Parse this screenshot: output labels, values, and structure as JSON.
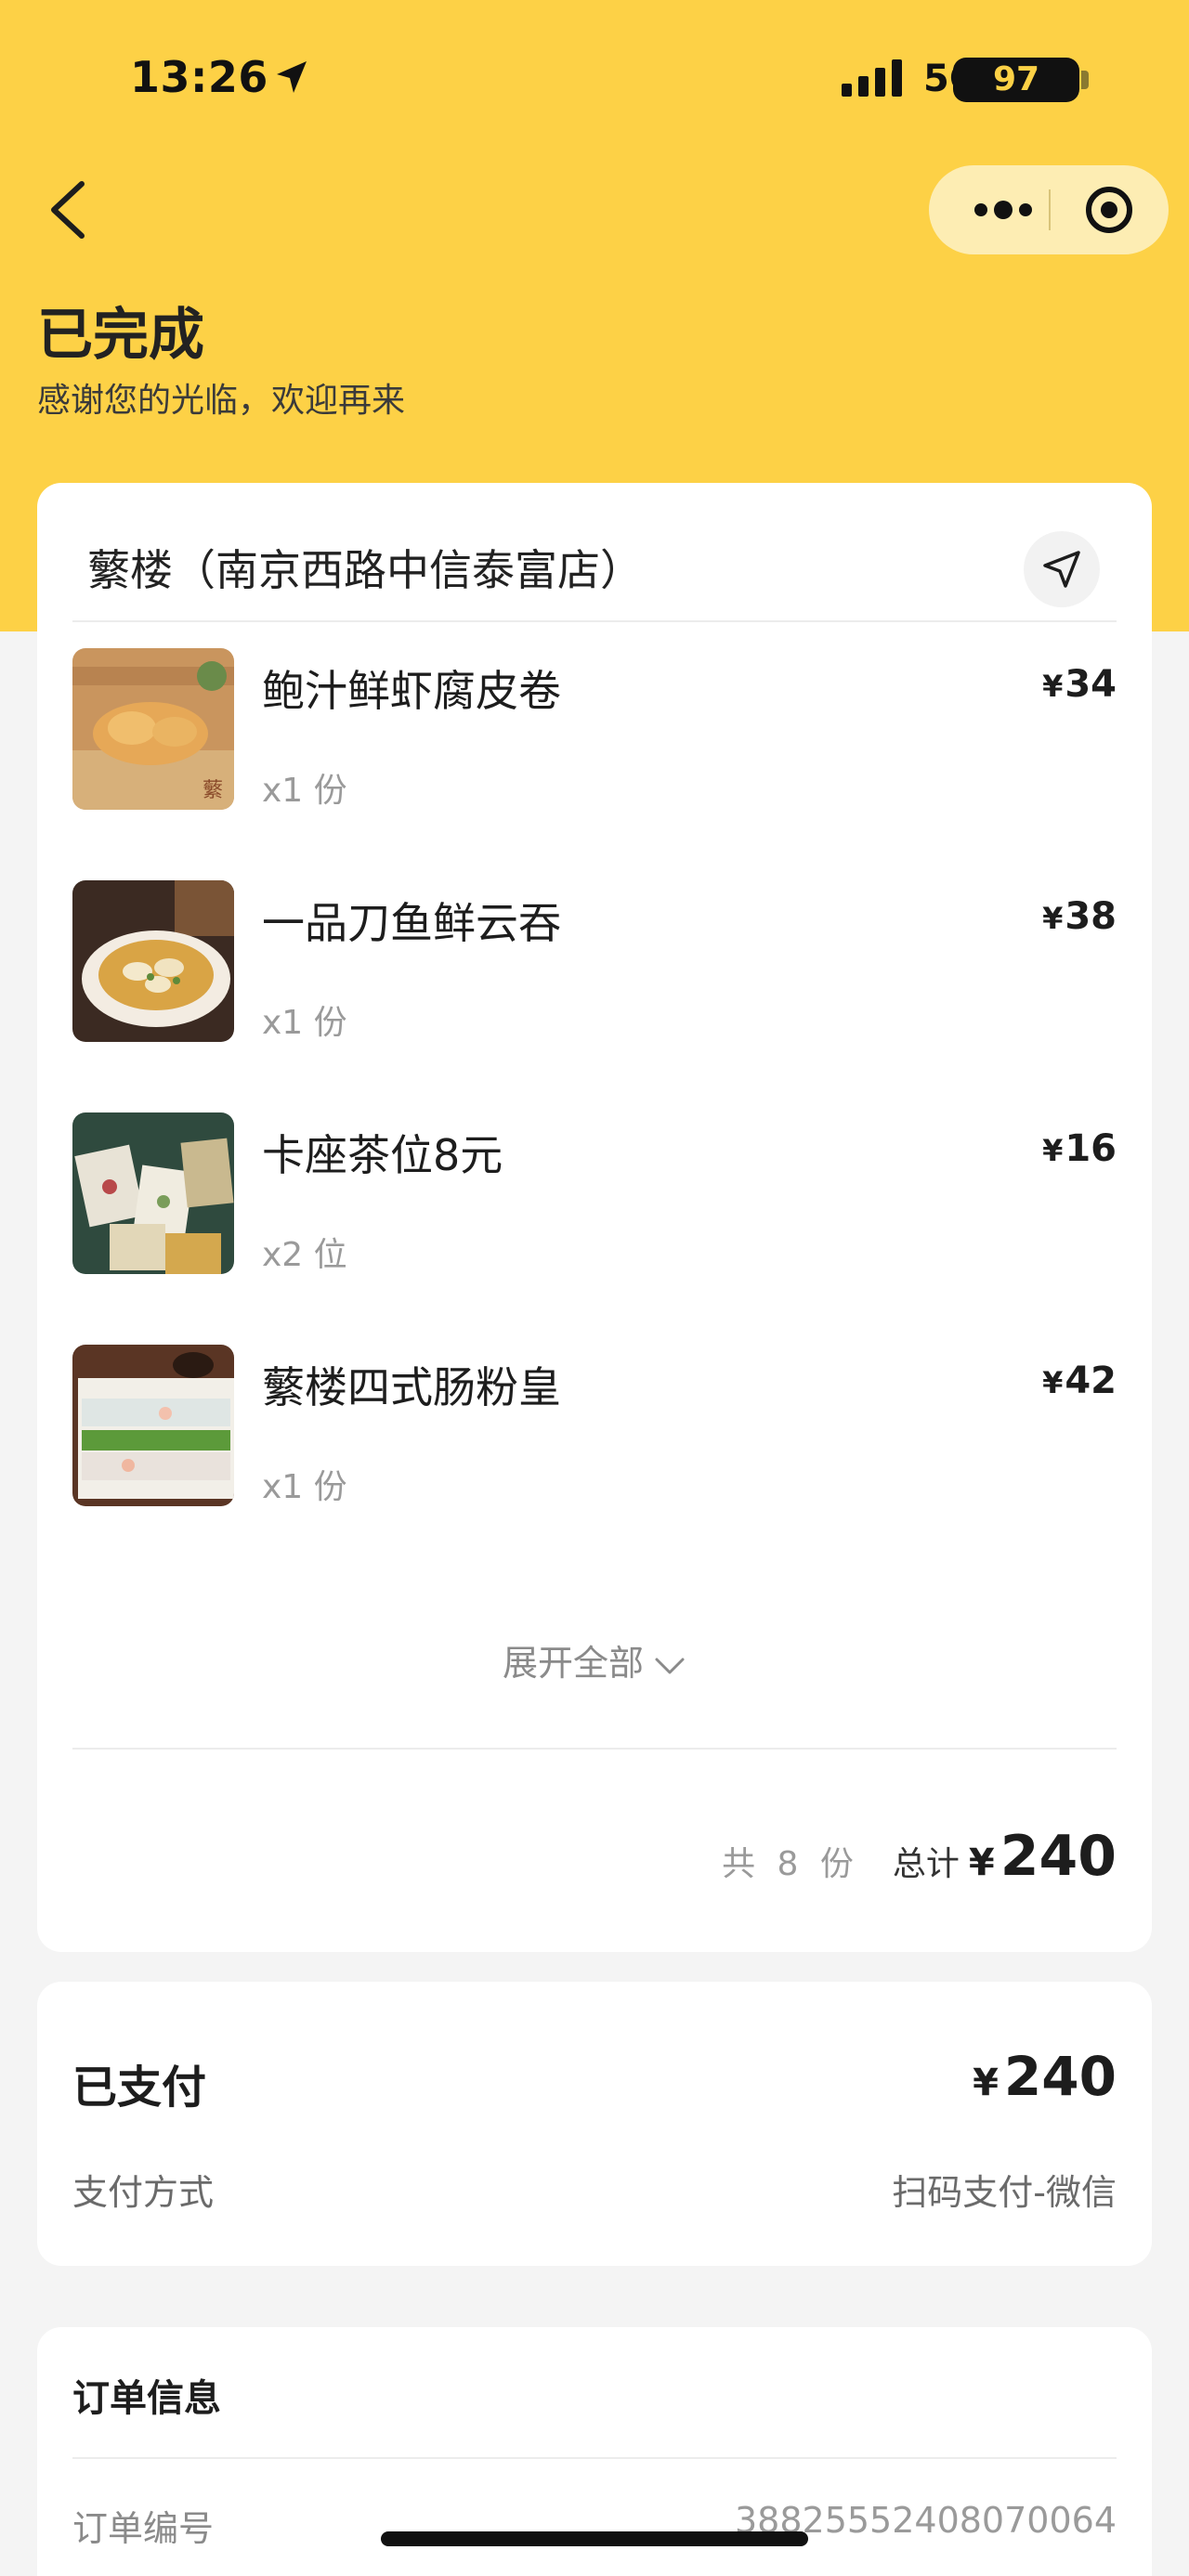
{
  "status_bar": {
    "time": "13:26",
    "network": "5G",
    "battery": "97"
  },
  "header": {
    "title": "已完成",
    "subtitle": "感谢您的光临，欢迎再来",
    "accent_color": "#fdd146"
  },
  "store": {
    "name": "蘩楼（南京西路中信泰富店）"
  },
  "items": [
    {
      "name": "鲍汁鲜虾腐皮卷",
      "qty": "x1 份",
      "currency": "¥",
      "price": "34"
    },
    {
      "name": "一品刀鱼鲜云吞",
      "qty": "x1 份",
      "currency": "¥",
      "price": "38"
    },
    {
      "name": "卡座茶位8元",
      "qty": "x2 位",
      "currency": "¥",
      "price": "16"
    },
    {
      "name": "蘩楼四式肠粉皇",
      "qty": "x1 份",
      "currency": "¥",
      "price": "42"
    }
  ],
  "expand_label": "展开全部",
  "summary": {
    "count": "共 8 份",
    "total_label": "总计",
    "currency": "¥",
    "total": "240"
  },
  "payment": {
    "status": "已支付",
    "currency": "¥",
    "amount": "240",
    "method_label": "支付方式",
    "method_value": "扫码支付-微信"
  },
  "order_info": {
    "title": "订单信息",
    "number_label": "订单编号",
    "number_value": "38825552408070064"
  },
  "icons": {
    "back": "back-chevron-icon",
    "more": "more-dots-icon",
    "target": "close-target-icon",
    "navigate": "navigation-arrow-icon",
    "expand": "chevron-down-icon"
  }
}
